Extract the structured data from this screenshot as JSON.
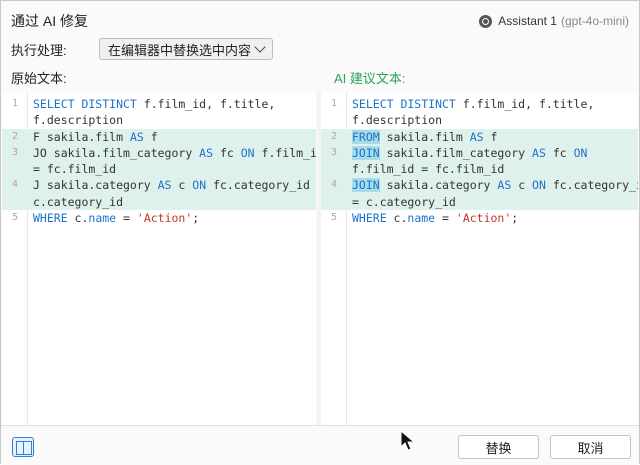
{
  "dialog": {
    "title": "通过 AI 修复",
    "assistant_name": "Assistant 1",
    "assistant_model": "(gpt-4o-mini)"
  },
  "action": {
    "label": "执行处理:",
    "selected": "在编辑器中替换选中内容"
  },
  "original": {
    "label": "原始文本:",
    "lines": [
      {
        "num": "1",
        "changed": false,
        "rows": [
          [
            [
              "kw",
              "SELECT DISTINCT"
            ],
            [
              "t",
              " f.film_id, f.title,"
            ]
          ],
          [
            [
              "t",
              "f.description"
            ]
          ]
        ]
      },
      {
        "num": "2",
        "changed": true,
        "rows": [
          [
            [
              "t",
              "F sakila.film "
            ],
            [
              "kw",
              "AS"
            ],
            [
              "t",
              " f"
            ]
          ]
        ]
      },
      {
        "num": "3",
        "changed": true,
        "rows": [
          [
            [
              "t",
              "JO sakila.film_category "
            ],
            [
              "kw",
              "AS"
            ],
            [
              "t",
              " fc "
            ],
            [
              "kw",
              "ON"
            ],
            [
              "t",
              " f.film_id"
            ]
          ],
          [
            [
              "t",
              "= fc.film_id"
            ]
          ]
        ]
      },
      {
        "num": "4",
        "changed": true,
        "rows": [
          [
            [
              "t",
              "J sakila.category "
            ],
            [
              "kw",
              "AS"
            ],
            [
              "t",
              " c "
            ],
            [
              "kw",
              "ON"
            ],
            [
              "t",
              " fc.category_id ="
            ]
          ],
          [
            [
              "t",
              "c.category_id"
            ]
          ]
        ]
      },
      {
        "num": "5",
        "changed": false,
        "rows": [
          [
            [
              "kw",
              "WHERE"
            ],
            [
              "t",
              " c."
            ],
            [
              "kw",
              "name"
            ],
            [
              "t",
              " = "
            ],
            [
              "str",
              "'Action'"
            ],
            [
              "t",
              ";"
            ]
          ]
        ]
      }
    ]
  },
  "suggested": {
    "label": "AI 建议文本:",
    "lines": [
      {
        "num": "1",
        "changed": false,
        "rows": [
          [
            [
              "kw",
              "SELECT DISTINCT"
            ],
            [
              "t",
              " f.film_id, f.title,"
            ]
          ],
          [
            [
              "t",
              "f.description"
            ]
          ]
        ]
      },
      {
        "num": "2",
        "changed": true,
        "rows": [
          [
            [
              "kwh",
              "FROM"
            ],
            [
              "t",
              " sakila.film "
            ],
            [
              "kw",
              "AS"
            ],
            [
              "t",
              " f"
            ]
          ]
        ]
      },
      {
        "num": "3",
        "changed": true,
        "rows": [
          [
            [
              "kwh",
              "JOIN"
            ],
            [
              "t",
              " sakila.film_category "
            ],
            [
              "kw",
              "AS"
            ],
            [
              "t",
              " fc "
            ],
            [
              "kw",
              "ON"
            ]
          ],
          [
            [
              "t",
              "f.film_id = fc.film_id"
            ]
          ]
        ]
      },
      {
        "num": "4",
        "changed": true,
        "rows": [
          [
            [
              "kwh",
              "JOIN"
            ],
            [
              "t",
              " sakila.category "
            ],
            [
              "kw",
              "AS"
            ],
            [
              "t",
              " c "
            ],
            [
              "kw",
              "ON"
            ],
            [
              "t",
              " fc.category_id"
            ]
          ],
          [
            [
              "t",
              "= c.category_id"
            ]
          ]
        ]
      },
      {
        "num": "5",
        "changed": false,
        "rows": [
          [
            [
              "kw",
              "WHERE"
            ],
            [
              "t",
              " c."
            ],
            [
              "kw",
              "name"
            ],
            [
              "t",
              " = "
            ],
            [
              "str",
              "'Action'"
            ],
            [
              "t",
              ";"
            ]
          ]
        ]
      }
    ]
  },
  "footer": {
    "replace_label": "替换",
    "cancel_label": "取消"
  },
  "colors": {
    "keyword": "#1c73c9",
    "string": "#c2362b",
    "changed_bg": "#dff1ec",
    "ai_label": "#29a35f"
  },
  "icons": [
    "gpt-icon",
    "layout-split-icon",
    "mouse-cursor-icon"
  ]
}
